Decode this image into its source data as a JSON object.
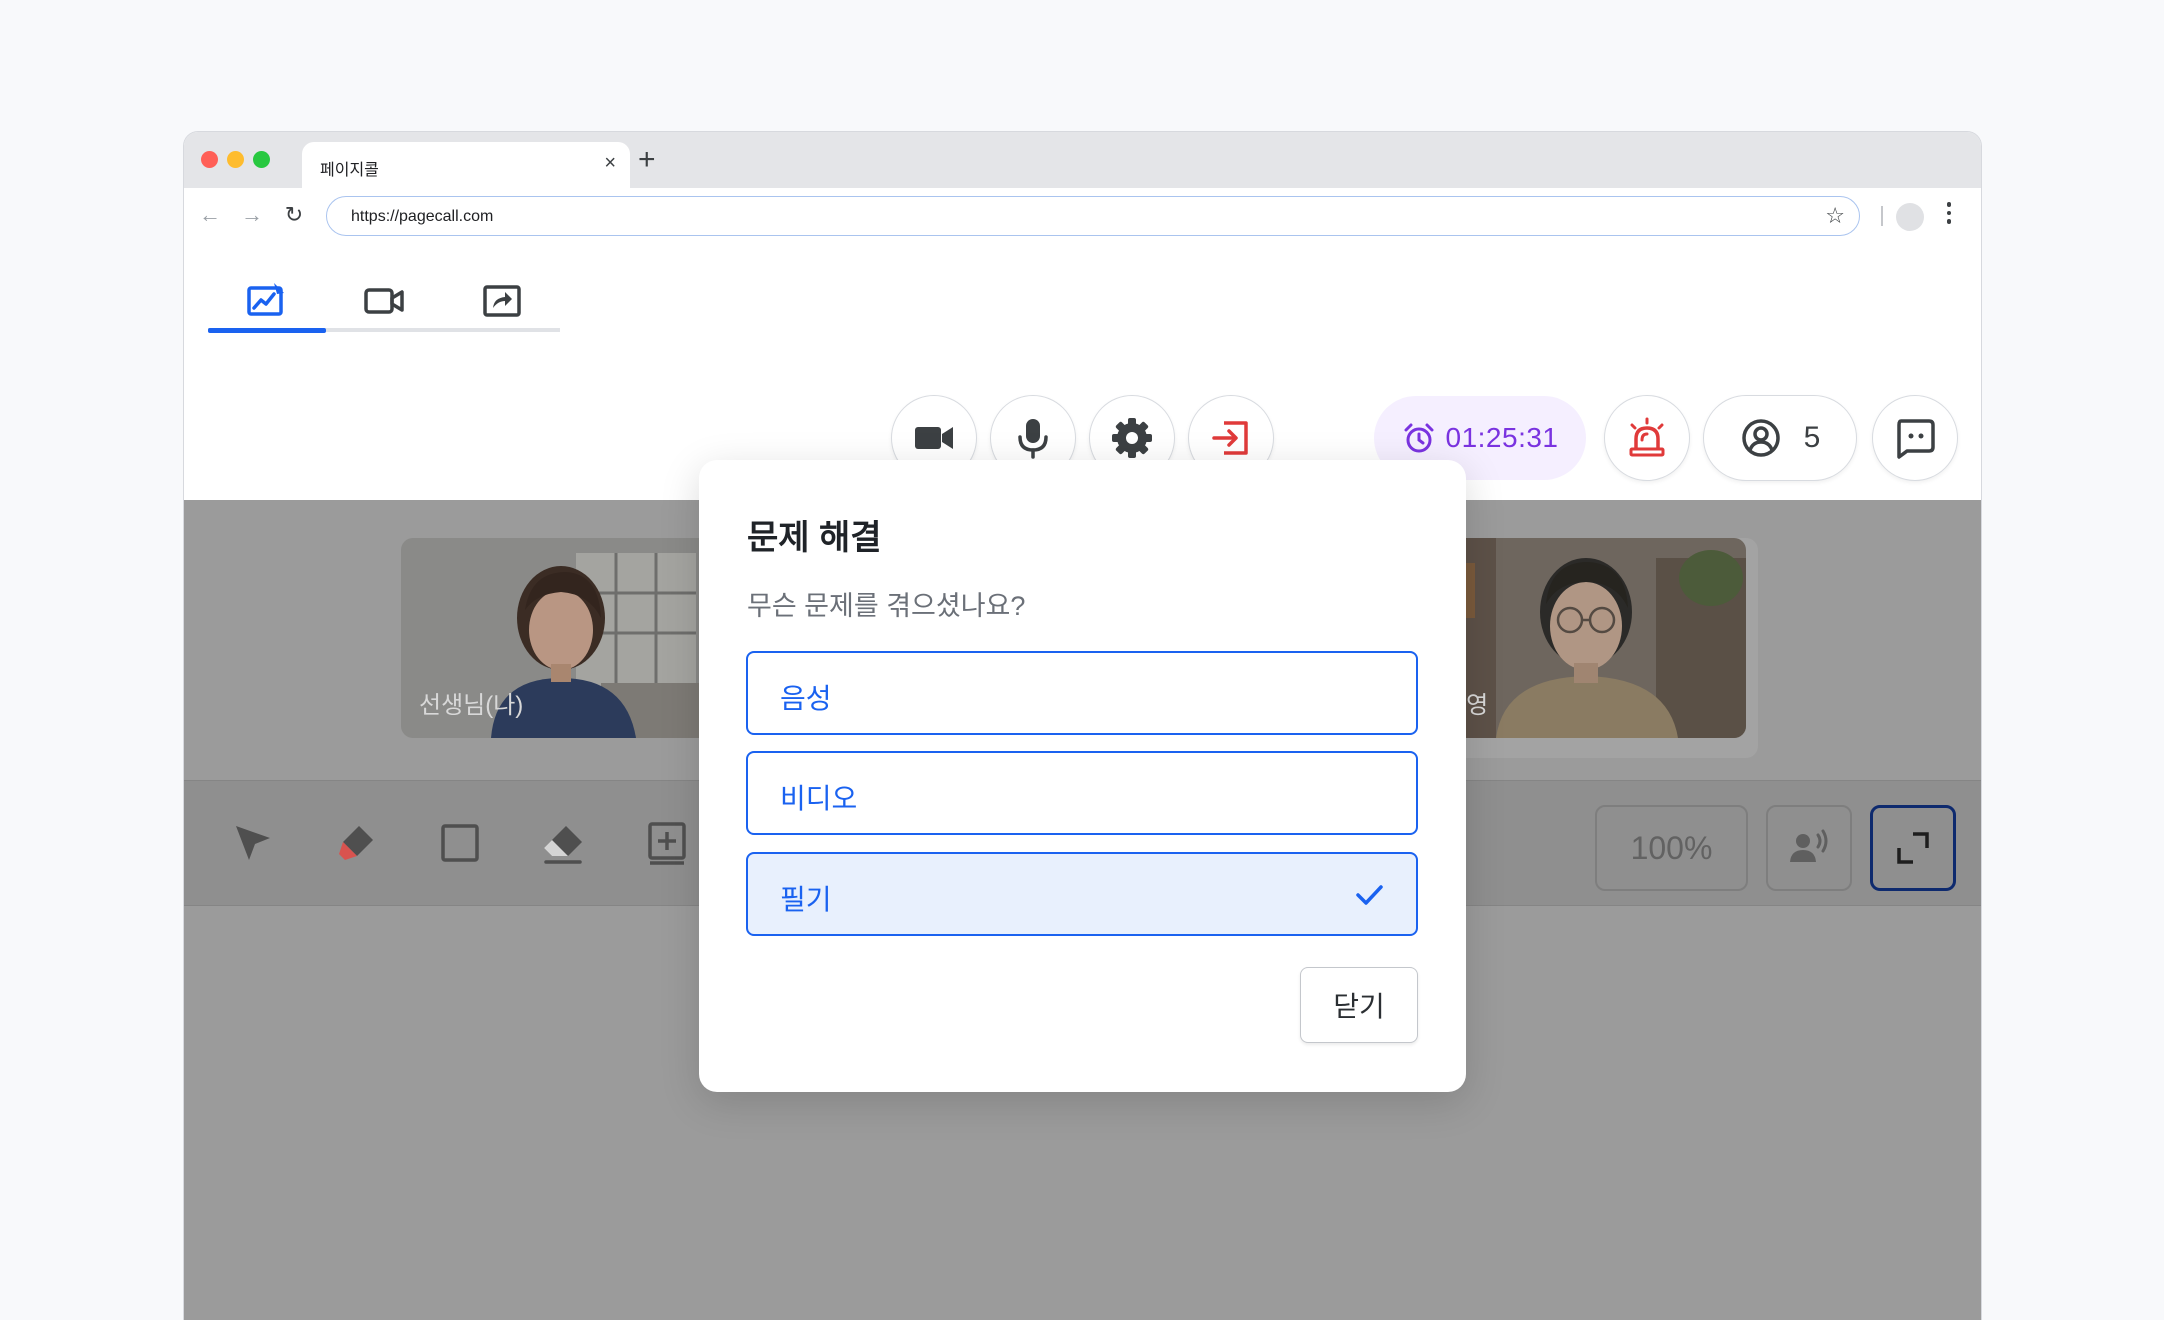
{
  "browser": {
    "tab_title": "페이지콜",
    "tab_close": "×",
    "new_tab": "+",
    "url": "https://pagecall.com",
    "nav": {
      "back": "←",
      "forward": "→",
      "reload": "↻"
    },
    "star": "☆"
  },
  "header": {
    "view_tabs": [
      {
        "icon": "whiteboard-icon",
        "active": true
      },
      {
        "icon": "video-camera-icon",
        "active": false
      },
      {
        "icon": "screen-share-icon",
        "active": false
      }
    ],
    "controls": [
      {
        "icon": "video-camera-icon"
      },
      {
        "icon": "microphone-icon"
      },
      {
        "icon": "gear-icon"
      },
      {
        "icon": "exit-icon",
        "color": "#e03a3a"
      }
    ],
    "timer": {
      "icon": "alarm-clock-icon",
      "value": "01:25:31",
      "color": "#7a33e0"
    },
    "alert": {
      "icon": "siren-icon",
      "color": "#e03a3a"
    },
    "participants": {
      "icon": "user-circle-icon",
      "count": "5"
    },
    "chat": {
      "icon": "chat-icon"
    }
  },
  "video_tiles": [
    {
      "name": "선생님(나)"
    },
    {
      "name": ""
    },
    {
      "name": ""
    },
    {
      "name": "수영"
    }
  ],
  "tools": {
    "items": [
      "pointer-icon",
      "pen-icon",
      "rectangle-icon",
      "eraser-icon",
      "add-page-icon"
    ],
    "zoom": "100%",
    "pen_color": "#d9534f"
  },
  "dialog": {
    "title": "문제 해결",
    "subtitle": "무슨 문제를 겪으셨나요?",
    "options": [
      {
        "label": "음성",
        "selected": false
      },
      {
        "label": "비디오",
        "selected": false
      },
      {
        "label": "필기",
        "selected": true
      }
    ],
    "close_label": "닫기",
    "accent": "#1a62f0"
  }
}
